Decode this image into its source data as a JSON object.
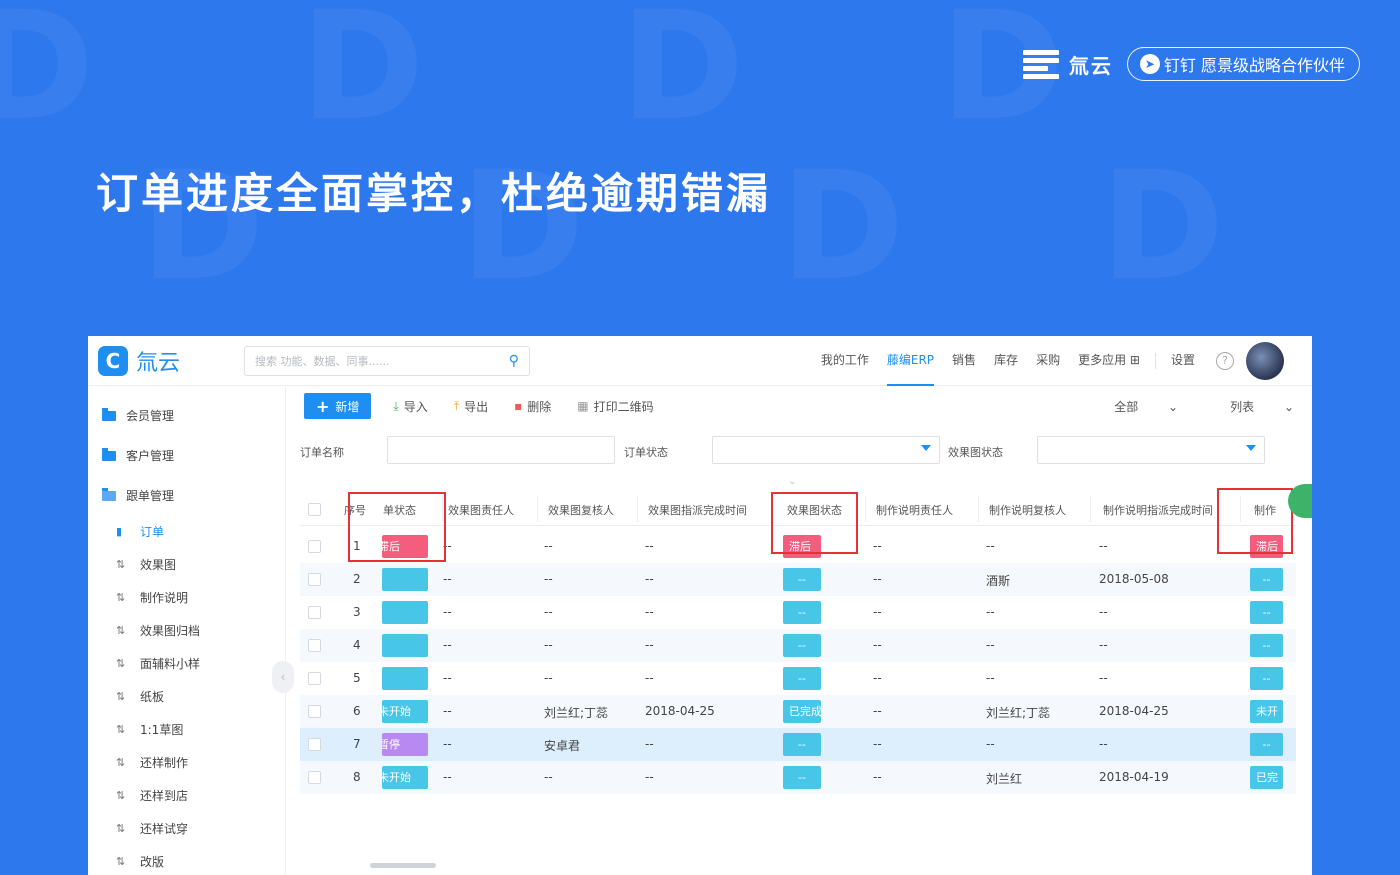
{
  "brand": {
    "name": "氚云",
    "partner_badge": "钉钉 愿景级战略合作伙伴"
  },
  "headline": "订单进度全面掌控，杜绝逾期错漏",
  "app": {
    "logo_text": "氚云",
    "search_placeholder": "搜索 功能、数据、同事......",
    "nav": [
      "我的工作",
      "藤编ERP",
      "销售",
      "库存",
      "采购",
      "更多应用"
    ],
    "nav_settings": "设置",
    "sidebar": {
      "groups": [
        "会员管理",
        "客户管理",
        "跟单管理"
      ],
      "items": [
        "订单",
        "效果图",
        "制作说明",
        "效果图归档",
        "面辅料小样",
        "纸板",
        "1:1草图",
        "还样制作",
        "还样到店",
        "还样试穿",
        "改版"
      ]
    },
    "toolbar": {
      "new": "新增",
      "import": "导入",
      "export": "导出",
      "delete": "删除",
      "print_qr": "打印二维码",
      "scope": "全部",
      "view": "列表"
    },
    "filters": {
      "order_name": "订单名称",
      "order_status": "订单状态",
      "render_status": "效果图状态"
    },
    "table": {
      "headers": [
        "序号",
        "单状态",
        "效果图责任人",
        "效果图复核人",
        "效果图指派完成时间",
        "效果图状态",
        "制作说明责任人",
        "制作说明复核人",
        "制作说明指派完成时间",
        "制作"
      ],
      "rows": [
        {
          "no": "1",
          "status": "滞后",
          "status_color": "#f55d7e",
          "owner": "--",
          "reviewer": "--",
          "due": "--",
          "render": "滞后",
          "render_color": "#f55d7e",
          "m_owner": "--",
          "m_reviewer": "--",
          "m_due": "--",
          "make": "滞后",
          "make_color": "#f55d7e"
        },
        {
          "no": "2",
          "status": "",
          "status_color": "#47c6e8",
          "owner": "--",
          "reviewer": "--",
          "due": "--",
          "render": "--",
          "render_color": "#47c6e8",
          "m_owner": "--",
          "m_reviewer": "酒斯",
          "m_due": "2018-05-08",
          "make": "--",
          "make_color": "#47c6e8"
        },
        {
          "no": "3",
          "status": "",
          "status_color": "#47c6e8",
          "owner": "--",
          "reviewer": "--",
          "due": "--",
          "render": "--",
          "render_color": "#47c6e8",
          "m_owner": "--",
          "m_reviewer": "--",
          "m_due": "--",
          "make": "--",
          "make_color": "#47c6e8"
        },
        {
          "no": "4",
          "status": "",
          "status_color": "#47c6e8",
          "owner": "--",
          "reviewer": "--",
          "due": "--",
          "render": "--",
          "render_color": "#47c6e8",
          "m_owner": "--",
          "m_reviewer": "--",
          "m_due": "--",
          "make": "--",
          "make_color": "#47c6e8"
        },
        {
          "no": "5",
          "status": "",
          "status_color": "#47c6e8",
          "owner": "--",
          "reviewer": "--",
          "due": "--",
          "render": "--",
          "render_color": "#47c6e8",
          "m_owner": "--",
          "m_reviewer": "--",
          "m_due": "--",
          "make": "--",
          "make_color": "#47c6e8"
        },
        {
          "no": "6",
          "status": "未开始",
          "status_color": "#47c6e8",
          "owner": "--",
          "reviewer": "刘兰红;丁蕊",
          "due": "2018-04-25",
          "render": "已完成",
          "render_color": "#47c6e8",
          "m_owner": "--",
          "m_reviewer": "刘兰红;丁蕊",
          "m_due": "2018-04-25",
          "make": "未开",
          "make_color": "#47c6e8"
        },
        {
          "no": "7",
          "status": "暂停",
          "status_color": "#b889f0",
          "owner": "--",
          "reviewer": "安卓君",
          "due": "--",
          "render": "--",
          "render_color": "#47c6e8",
          "m_owner": "--",
          "m_reviewer": "--",
          "m_due": "--",
          "make": "--",
          "make_color": "#47c6e8"
        },
        {
          "no": "8",
          "status": "未开始",
          "status_color": "#47c6e8",
          "owner": "--",
          "reviewer": "--",
          "due": "--",
          "render": "--",
          "render_color": "#47c6e8",
          "m_owner": "--",
          "m_reviewer": "刘兰红",
          "m_due": "2018-04-19",
          "make": "已完",
          "make_color": "#47c6e8"
        }
      ]
    }
  }
}
